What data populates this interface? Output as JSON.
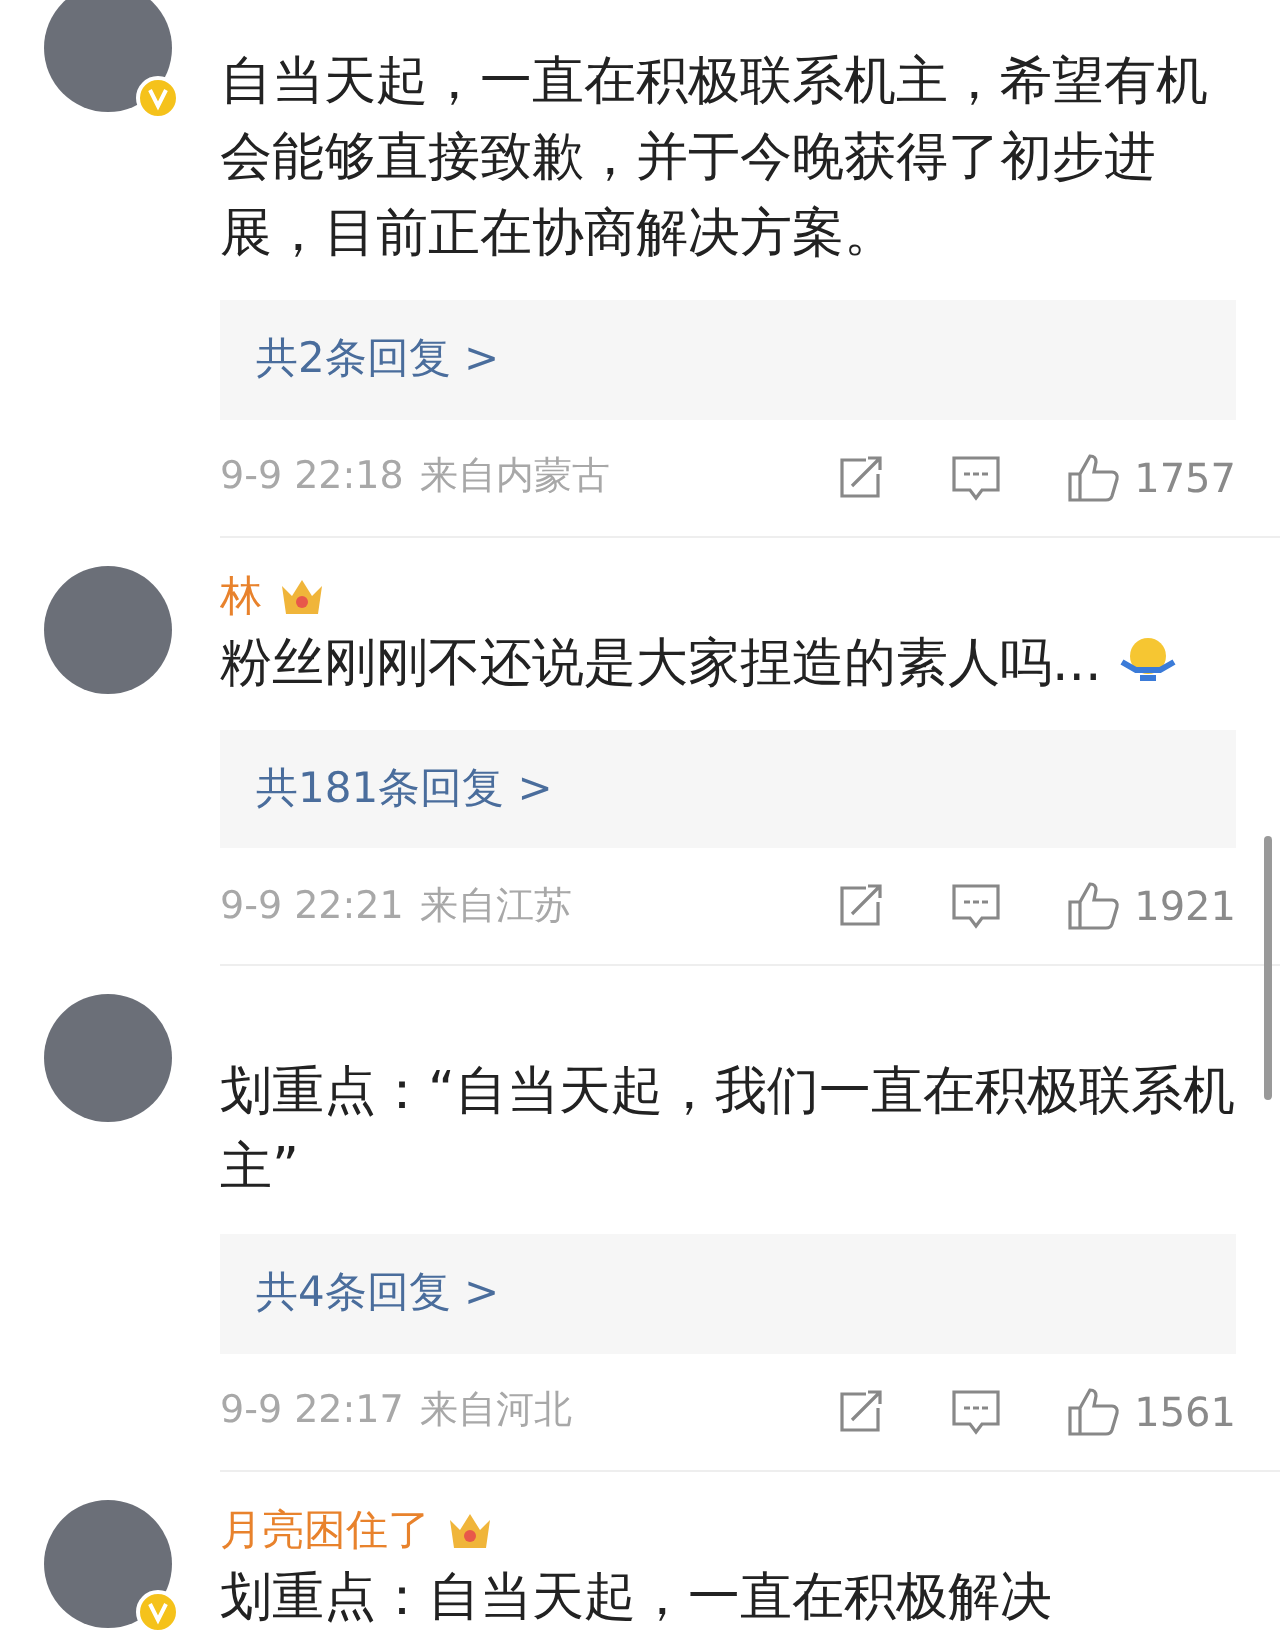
{
  "comments": [
    {
      "verified": true,
      "crown": false,
      "text": "自当天起，一直在积极联系机主，希望有机会能够直接致歉，并于今晚获得了初步进展，目前正在协商解决方案。",
      "replies": "共2条回复 >",
      "date": "9-9 22:18",
      "location": "来自内蒙古",
      "likes": "1757"
    },
    {
      "username": "林",
      "verified": false,
      "crown": true,
      "text": "粉丝刚刚不还说是大家捏造的素人吗...",
      "emoji": true,
      "replies": "共181条回复 >",
      "date": "9-9 22:21",
      "location": "来自江苏",
      "likes": "1921"
    },
    {
      "verified": false,
      "crown": false,
      "text": "划重点：“自当天起，我们一直在积极联系机主”",
      "replies": "共4条回复 >",
      "date": "9-9 22:17",
      "location": "来自河北",
      "likes": "1561"
    },
    {
      "username": "月亮困住了",
      "verified": true,
      "crown": true,
      "text": "划重点：自当天起，一直在积极解决"
    }
  ]
}
